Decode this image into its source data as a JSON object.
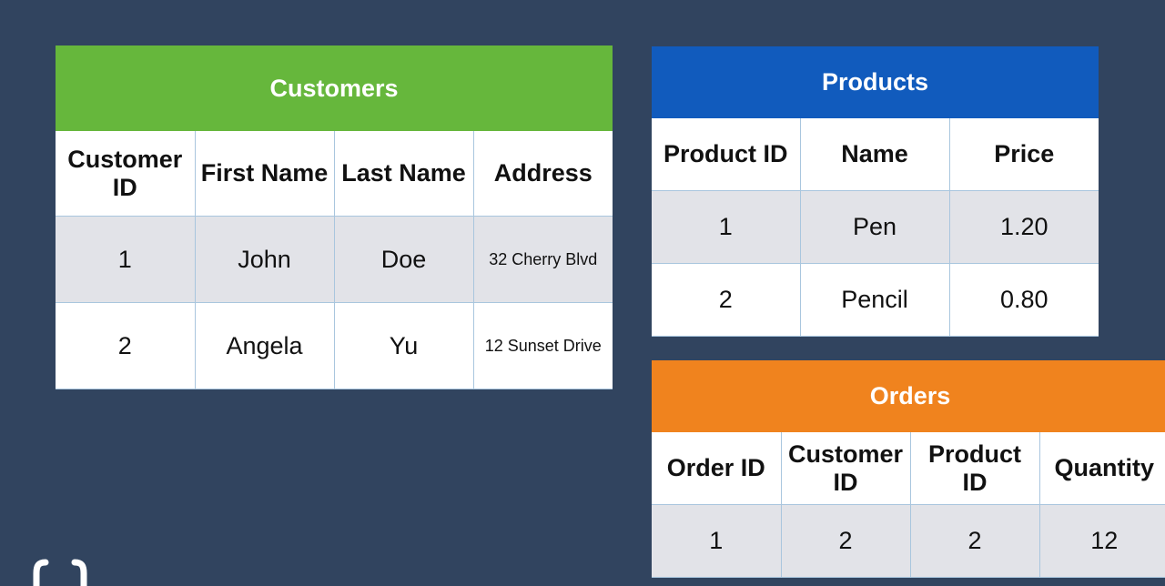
{
  "customers": {
    "title": "Customers",
    "headers": [
      "Customer ID",
      "First Name",
      "Last Name",
      "Address"
    ],
    "rows": [
      [
        "1",
        "John",
        "Doe",
        "32 Cherry Blvd"
      ],
      [
        "2",
        "Angela",
        "Yu",
        "12 Sunset Drive"
      ]
    ]
  },
  "products": {
    "title": "Products",
    "headers": [
      "Product ID",
      "Name",
      "Price"
    ],
    "rows": [
      [
        "1",
        "Pen",
        "1.20"
      ],
      [
        "2",
        "Pencil",
        "0.80"
      ]
    ]
  },
  "orders": {
    "title": "Orders",
    "headers": [
      "Order ID",
      "Customer ID",
      "Product ID",
      "Quantity"
    ],
    "rows": [
      [
        "1",
        "2",
        "2",
        "12"
      ]
    ]
  },
  "colors": {
    "background": "#31445f",
    "customers_header": "#66b73c",
    "products_header": "#115bbd",
    "orders_header": "#f0831e",
    "row_shaded": "#e2e3e8",
    "border": "#a9c6de"
  },
  "logo_icon": "curly-braces-icon"
}
